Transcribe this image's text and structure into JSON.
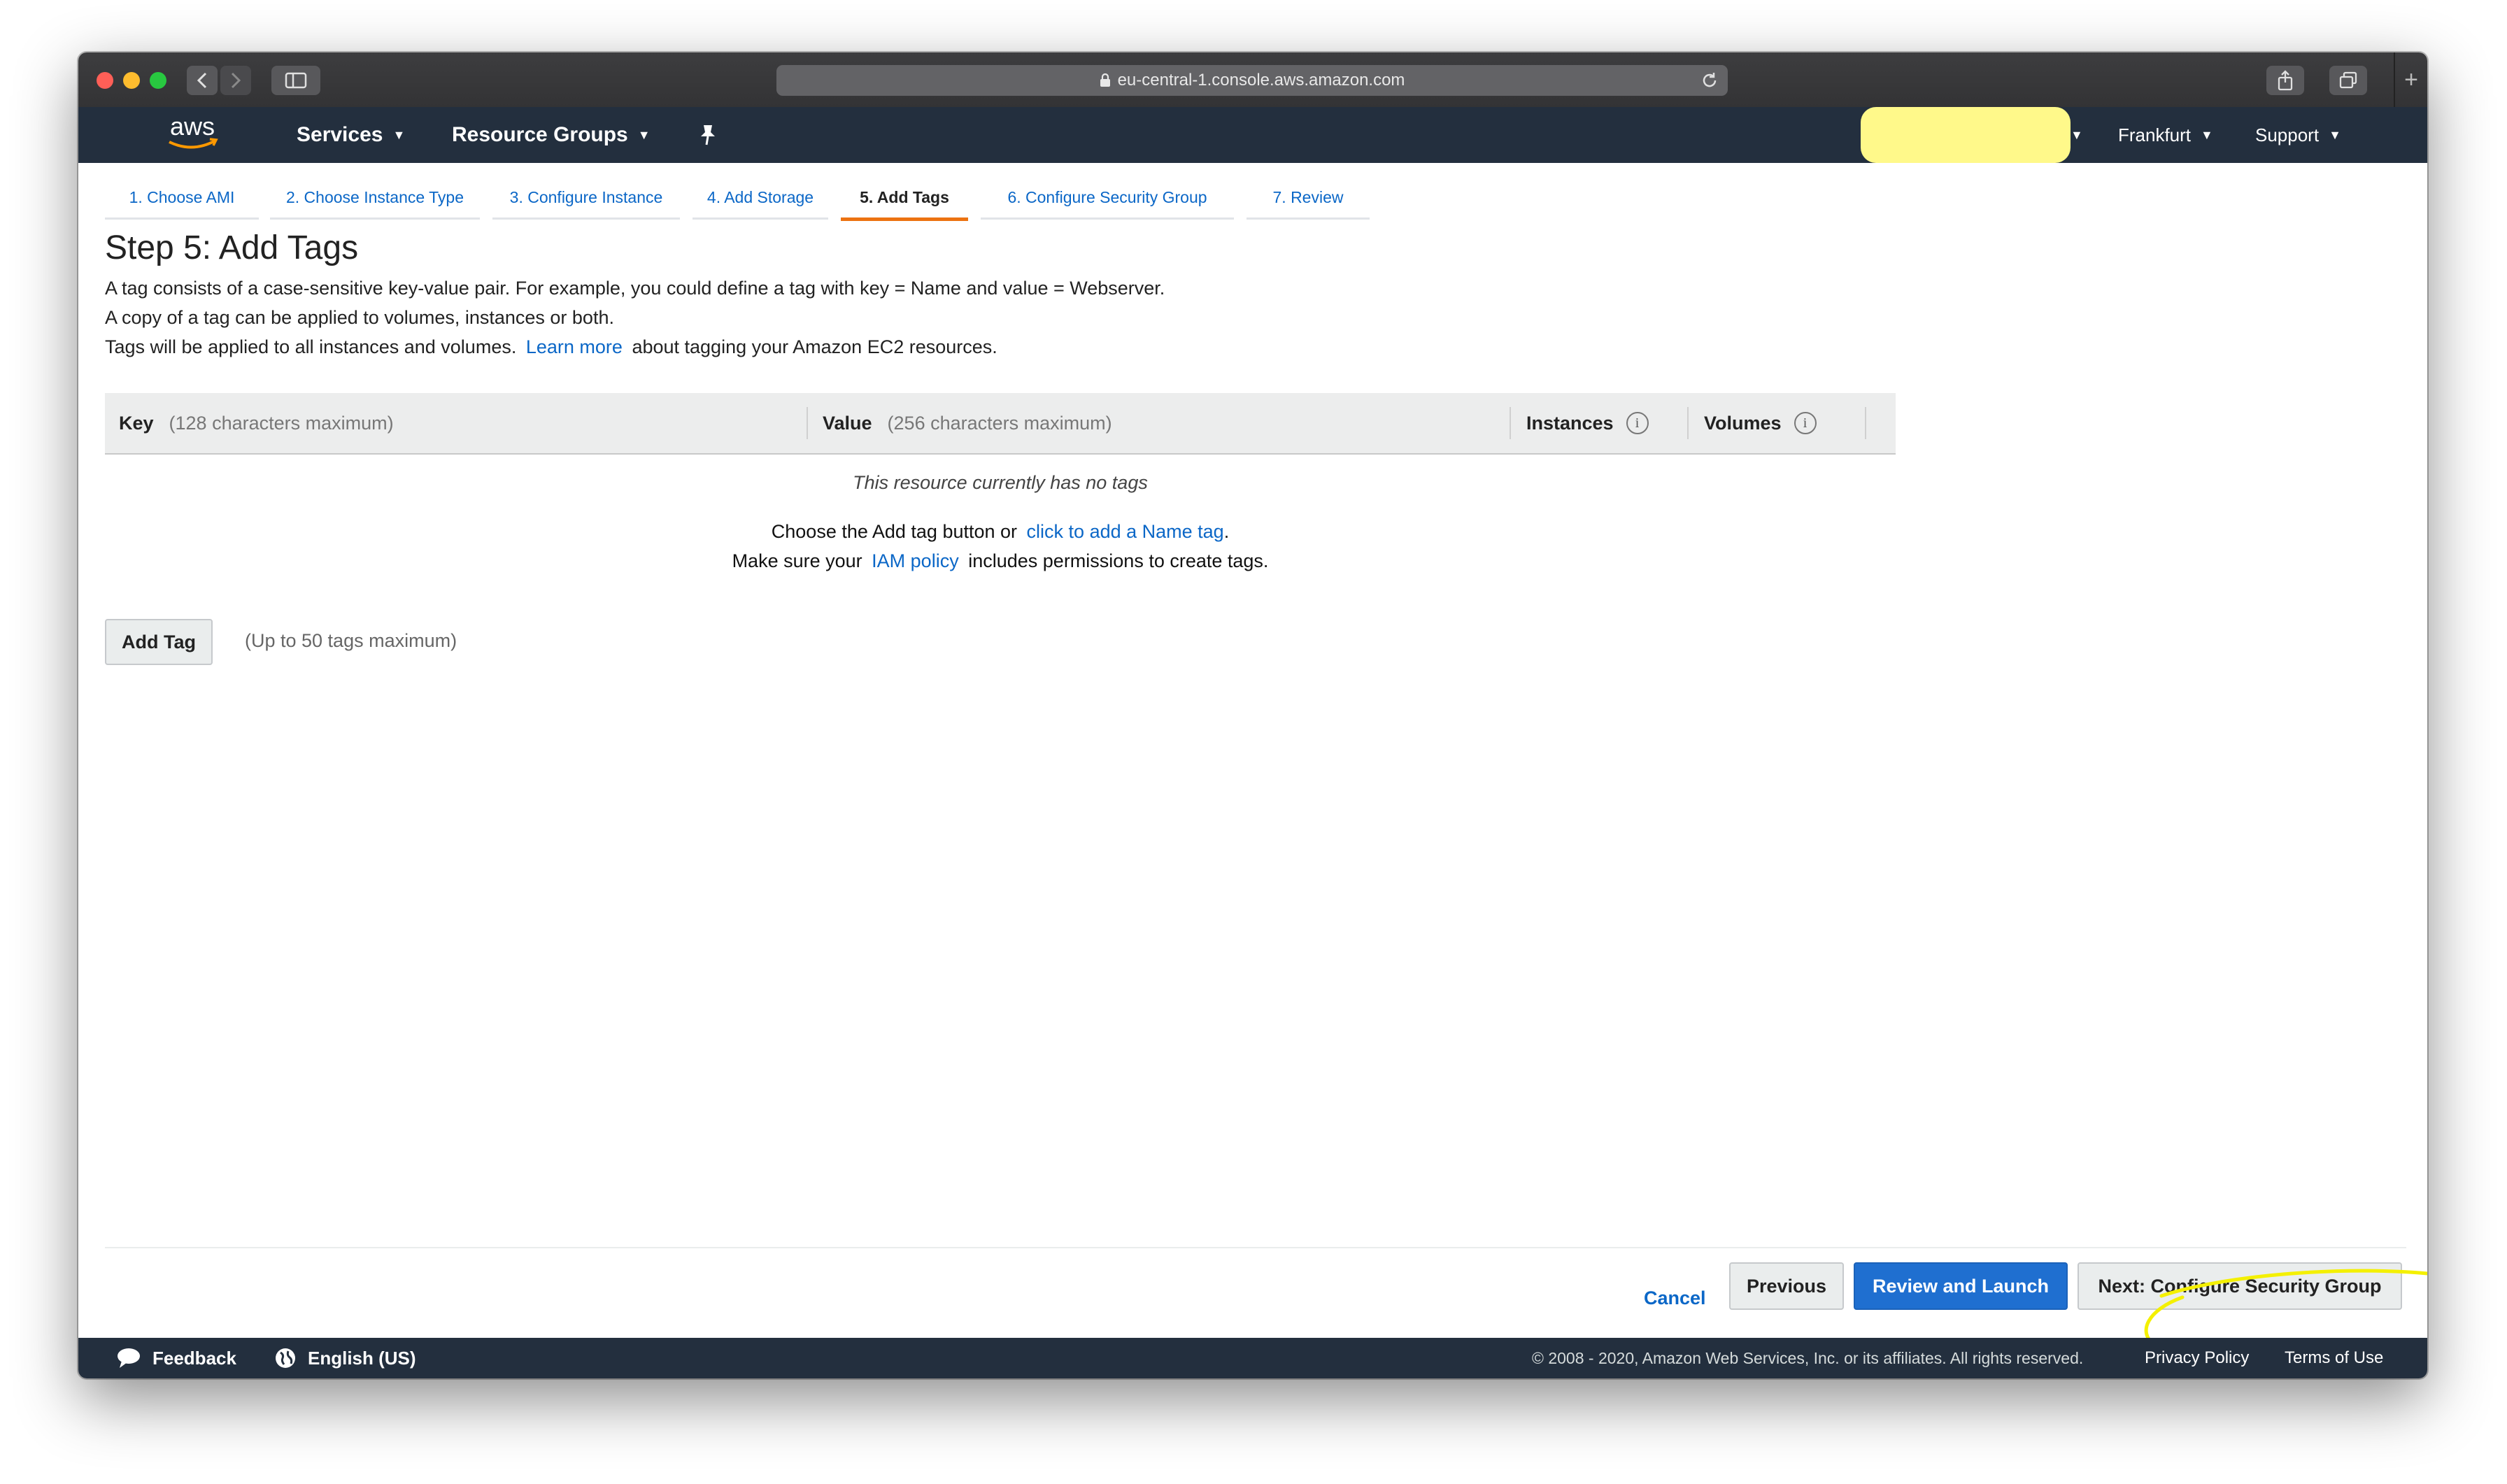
{
  "browser": {
    "url": "eu-central-1.console.aws.amazon.com"
  },
  "nav": {
    "logo_text": "aws",
    "services_label": "Services",
    "resource_groups_label": "Resource Groups",
    "region_label": "Frankfurt",
    "support_label": "Support"
  },
  "steps": [
    {
      "label": "1. Choose AMI",
      "active": false
    },
    {
      "label": "2. Choose Instance Type",
      "active": false
    },
    {
      "label": "3. Configure Instance",
      "active": false
    },
    {
      "label": "4. Add Storage",
      "active": false
    },
    {
      "label": "5. Add Tags",
      "active": true
    },
    {
      "label": "6. Configure Security Group",
      "active": false
    },
    {
      "label": "7. Review",
      "active": false
    }
  ],
  "page": {
    "title": "Step 5: Add Tags",
    "line1": "A tag consists of a case-sensitive key-value pair. For example, you could define a tag with key = Name and value = Webserver.",
    "line2": "A copy of a tag can be applied to volumes, instances or both.",
    "line3_before": "Tags will be applied to all instances and volumes.",
    "learn_more": "Learn more",
    "line3_after": "about tagging your Amazon EC2 resources."
  },
  "table": {
    "key_header": "Key",
    "key_hint": "(128 characters maximum)",
    "value_header": "Value",
    "value_hint": "(256 characters maximum)",
    "instances_header": "Instances",
    "volumes_header": "Volumes",
    "info_glyph": "i",
    "empty_text": "This resource currently has no tags",
    "help1_before": "Choose the Add tag button or",
    "help1_link": "click to add a Name tag",
    "help1_after": ".",
    "help2_before": "Make sure your",
    "help2_link": "IAM policy",
    "help2_after": "includes permissions to create tags."
  },
  "add_tag": {
    "button_label": "Add Tag",
    "hint": "(Up to 50 tags maximum)"
  },
  "actions": {
    "cancel": "Cancel",
    "previous": "Previous",
    "review_launch": "Review and Launch",
    "next": "Next: Configure Security Group"
  },
  "footer": {
    "feedback": "Feedback",
    "language": "English (US)",
    "copyright": "© 2008 - 2020, Amazon Web Services, Inc. or its affiliates. All rights reserved.",
    "privacy": "Privacy Policy",
    "terms": "Terms of Use"
  },
  "colors": {
    "nav_bg": "#232f3e",
    "link": "#0b67c7",
    "active_tab": "#ec7211",
    "primary_button": "#1f6fd0",
    "highlight": "#fff98a"
  }
}
